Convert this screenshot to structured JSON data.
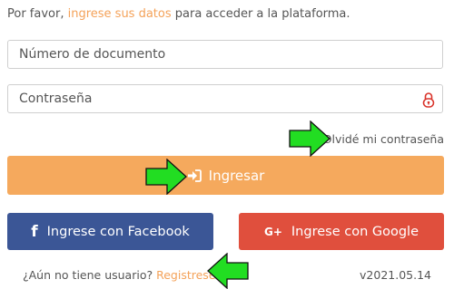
{
  "intro": {
    "prefix": "Por favor, ",
    "link": "ingrese sus datos",
    "suffix": " para acceder a la plataforma."
  },
  "form": {
    "document_placeholder": "Número de documento",
    "password_placeholder": "Contraseña",
    "forgot_label": "Olvidé mi contraseña",
    "login_label": "Ingresar"
  },
  "social": {
    "facebook_label": "Ingrese con Facebook",
    "facebook_icon": "f",
    "google_label": "Ingrese con Google",
    "google_icon": "G+"
  },
  "footer": {
    "question": "¿Aún no tiene usuario? ",
    "register_label": "Registrese",
    "version": "v2021.05.14"
  },
  "colors": {
    "accent": "#f5a95d",
    "facebook": "#3b5696",
    "google": "#e04f3d",
    "annotation_arrow": "#22dd22"
  }
}
